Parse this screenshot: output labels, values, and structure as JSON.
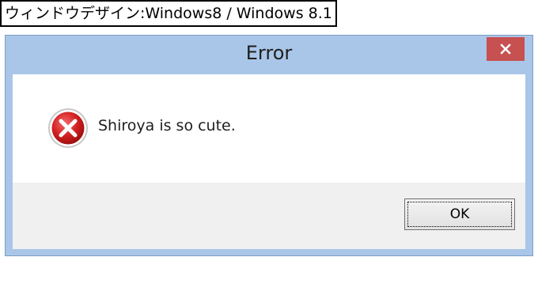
{
  "caption": {
    "text": "ウィンドウデザイン:Windows8 / Windows 8.1"
  },
  "dialog": {
    "title": "Error",
    "close_icon": "close-icon",
    "message_icon": "error-icon",
    "message": "Shiroya is so cute.",
    "ok_label": "OK"
  },
  "colors": {
    "frame": "#a9c6e8",
    "close_button": "#c75050",
    "error_icon": "#d42020",
    "button_area": "#f0f0f0"
  }
}
